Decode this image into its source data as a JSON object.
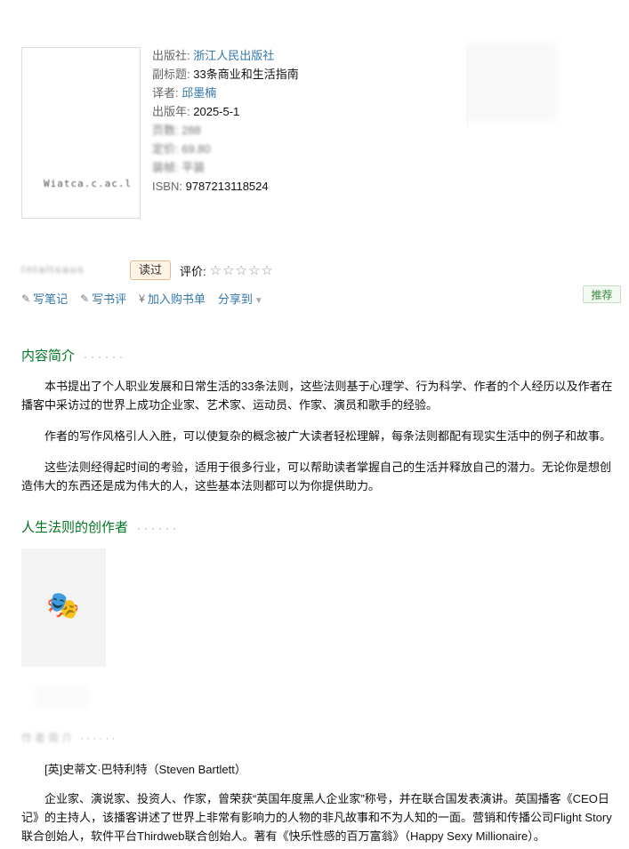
{
  "book": {
    "cover_blur_text": "Wiatca.c.ac.l",
    "publisher_label": "出版社:",
    "publisher": "浙江人民出版社",
    "subtitle_label": "副标题:",
    "subtitle": "33条商业和生活指南",
    "translator_label": "译者:",
    "translator": "邱墨楠",
    "pubdate_label": "出版年:",
    "pubdate": "2025-5-1",
    "blur_row_1": "页数: 288",
    "blur_row_2": "定价: 69.80",
    "blur_row_3": "装帧: 平装",
    "isbn_label": "ISBN:",
    "isbn": "9787213118524"
  },
  "actions": {
    "read_blur": "Intaltsaus",
    "read_button": "读过",
    "rating_label": "评价:",
    "stars": "☆☆☆☆☆",
    "write_note": "写笔记",
    "write_review": "写书评",
    "add_to_list": "加入购书单",
    "share": "分享到",
    "recommend": "推荐"
  },
  "intro": {
    "title": "内容简介",
    "dots": "······",
    "paragraphs": [
      "本书提出了个人职业发展和日常生活的33条法则，这些法则基于心理学、行为科学、作者的个人经历以及作者在播客中采访过的世界上成功企业家、艺术家、运动员、作家、演员和歌手的经验。",
      "作者的写作风格引人入胜，可以使复杂的概念被广大读者轻松理解，每条法则都配有现实生活中的例子和故事。",
      "这些法则经得起时间的考验，适用于很多行业，可以帮助读者掌握自己的生活并释放自己的潜力。无论你是想创造伟大的东西还是成为伟大的人，这些基本法则都可以为你提供助力。"
    ]
  },
  "creator": {
    "title": "人生法则的创作者",
    "dots": "······"
  },
  "author_section": {
    "blur_title": "作者简介",
    "dots": "······",
    "name_line": "[英]史蒂文·巴特利特（Steven Bartlett）",
    "bio": "企业家、演说家、投资人、作家，曾荣获“英国年度黑人企业家”称号，并在联合国发表演讲。英国播客《CEO日记》的主持人，该播客讲述了世界上非常有影响力的人物的非凡故事和不为人知的一面。营销和传播公司Flight Story联合创始人，软件平台Thirdweb联合创始人。著有《快乐性感的百万富翁》（Happy Sexy Millionaire）。"
  }
}
